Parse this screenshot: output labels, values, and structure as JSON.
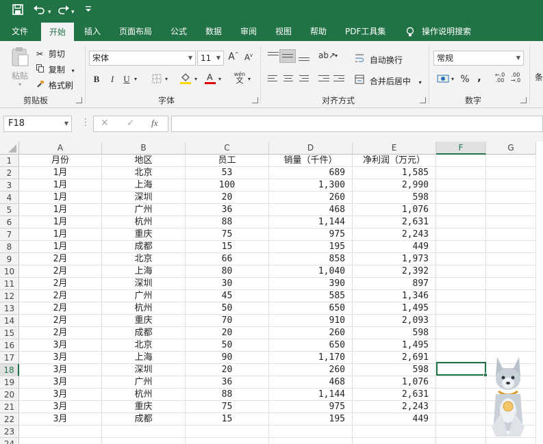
{
  "quick_access": {
    "save": "🖫",
    "undo": "↶",
    "redo": "↷",
    "more": "▾"
  },
  "tabs": [
    "文件",
    "开始",
    "插入",
    "页面布局",
    "公式",
    "数据",
    "审阅",
    "视图",
    "帮助",
    "PDF工具集",
    "操作说明搜索"
  ],
  "ribbon": {
    "clipboard": {
      "paste": "粘贴",
      "cut": "剪切",
      "copy": "复制",
      "format_painter": "格式刷",
      "label": "剪贴板"
    },
    "font": {
      "name": "宋体",
      "size": "11",
      "grow": "A",
      "shrink": "A",
      "bold": "B",
      "italic": "I",
      "underline": "U",
      "label": "字体",
      "phonetic": "wén"
    },
    "alignment": {
      "wrap_text": "自动换行",
      "merge_center": "合并后居中",
      "label": "对齐方式"
    },
    "number": {
      "format": "常规",
      "percent": "%",
      "comma": ",",
      "label": "数字",
      "inc_decimal": "←.0 .00",
      "dec_decimal": ".00 →.0"
    },
    "styles_partial": "条"
  },
  "formula_bar": {
    "name_box": "F18",
    "cancel": "✕",
    "enter": "✓",
    "fx": "fx",
    "value": ""
  },
  "colors": {
    "accent": "#217346",
    "ribbon_bg": "#f3f3f3"
  },
  "columns": [
    "A",
    "B",
    "C",
    "D",
    "E",
    "F",
    "G"
  ],
  "rows": [
    [
      "月份",
      "地区",
      "员工",
      "销量（千件）",
      "净利润（万元）"
    ],
    [
      "1月",
      "北京",
      "53",
      "689",
      "1,585"
    ],
    [
      "1月",
      "上海",
      "100",
      "1,300",
      "2,990"
    ],
    [
      "1月",
      "深圳",
      "20",
      "260",
      "598"
    ],
    [
      "1月",
      "广州",
      "36",
      "468",
      "1,076"
    ],
    [
      "1月",
      "杭州",
      "88",
      "1,144",
      "2,631"
    ],
    [
      "1月",
      "重庆",
      "75",
      "975",
      "2,243"
    ],
    [
      "1月",
      "成都",
      "15",
      "195",
      "449"
    ],
    [
      "2月",
      "北京",
      "66",
      "858",
      "1,973"
    ],
    [
      "2月",
      "上海",
      "80",
      "1,040",
      "2,392"
    ],
    [
      "2月",
      "深圳",
      "30",
      "390",
      "897"
    ],
    [
      "2月",
      "广州",
      "45",
      "585",
      "1,346"
    ],
    [
      "2月",
      "杭州",
      "50",
      "650",
      "1,495"
    ],
    [
      "2月",
      "重庆",
      "70",
      "910",
      "2,093"
    ],
    [
      "2月",
      "成都",
      "20",
      "260",
      "598"
    ],
    [
      "3月",
      "北京",
      "50",
      "650",
      "1,495"
    ],
    [
      "3月",
      "上海",
      "90",
      "1,170",
      "2,691"
    ],
    [
      "3月",
      "深圳",
      "20",
      "260",
      "598"
    ],
    [
      "3月",
      "广州",
      "36",
      "468",
      "1,076"
    ],
    [
      "3月",
      "杭州",
      "88",
      "1,144",
      "2,631"
    ],
    [
      "3月",
      "重庆",
      "75",
      "975",
      "2,243"
    ],
    [
      "3月",
      "成都",
      "15",
      "195",
      "449"
    ],
    [
      "",
      "",
      "",
      "",
      ""
    ],
    [
      "",
      "",
      "",
      "",
      ""
    ]
  ],
  "row_numbers": [
    "1",
    "2",
    "3",
    "4",
    "5",
    "6",
    "7",
    "8",
    "9",
    "10",
    "11",
    "12",
    "13",
    "14",
    "15",
    "16",
    "17",
    "18",
    "19",
    "20",
    "21",
    "22",
    "23",
    "24"
  ]
}
